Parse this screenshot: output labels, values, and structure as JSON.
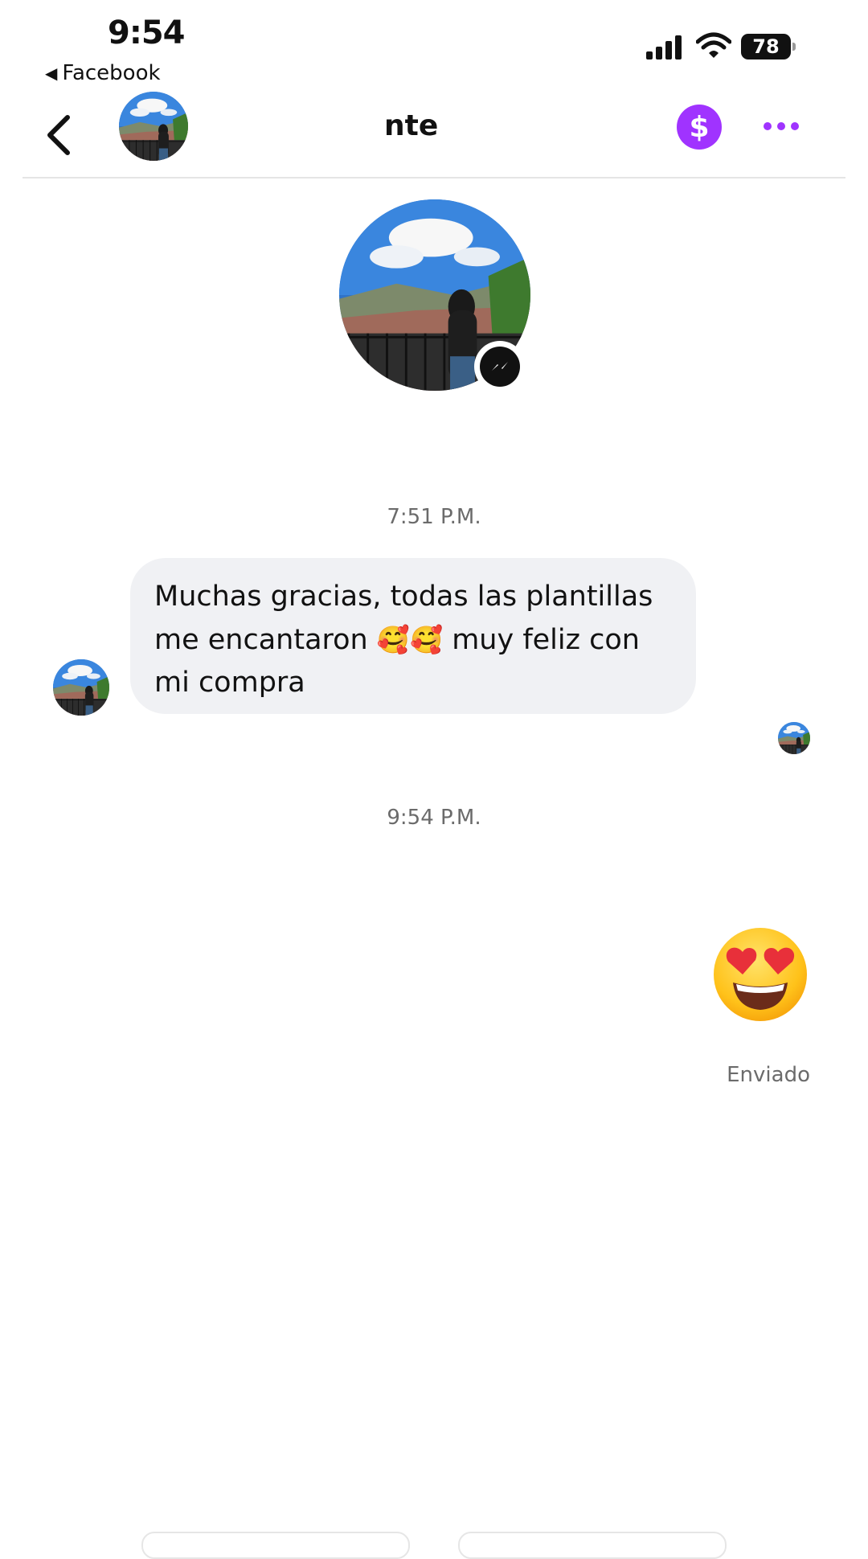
{
  "status_bar": {
    "time": "9:54",
    "back_app": "Facebook",
    "battery": "78"
  },
  "header": {
    "title": "nte",
    "pay_icon": "dollar-icon",
    "more_icon": "more-dots-icon"
  },
  "profile": {
    "badge_icon": "messenger-icon"
  },
  "messages": [
    {
      "timestamp": "7:51 P.M."
    },
    {
      "text_part1": "Muchas gracias, todas las plantillas me encantaron",
      "emoji": "🥰🥰",
      "text_part2": "muy feliz con mi compra"
    },
    {
      "timestamp": "9:54 P.M."
    },
    {
      "emoji": "😍",
      "status": "Enviado"
    }
  ],
  "colors": {
    "accent": "#a033ff",
    "bubble": "#f0f1f4",
    "muted": "#6b6b6b"
  }
}
